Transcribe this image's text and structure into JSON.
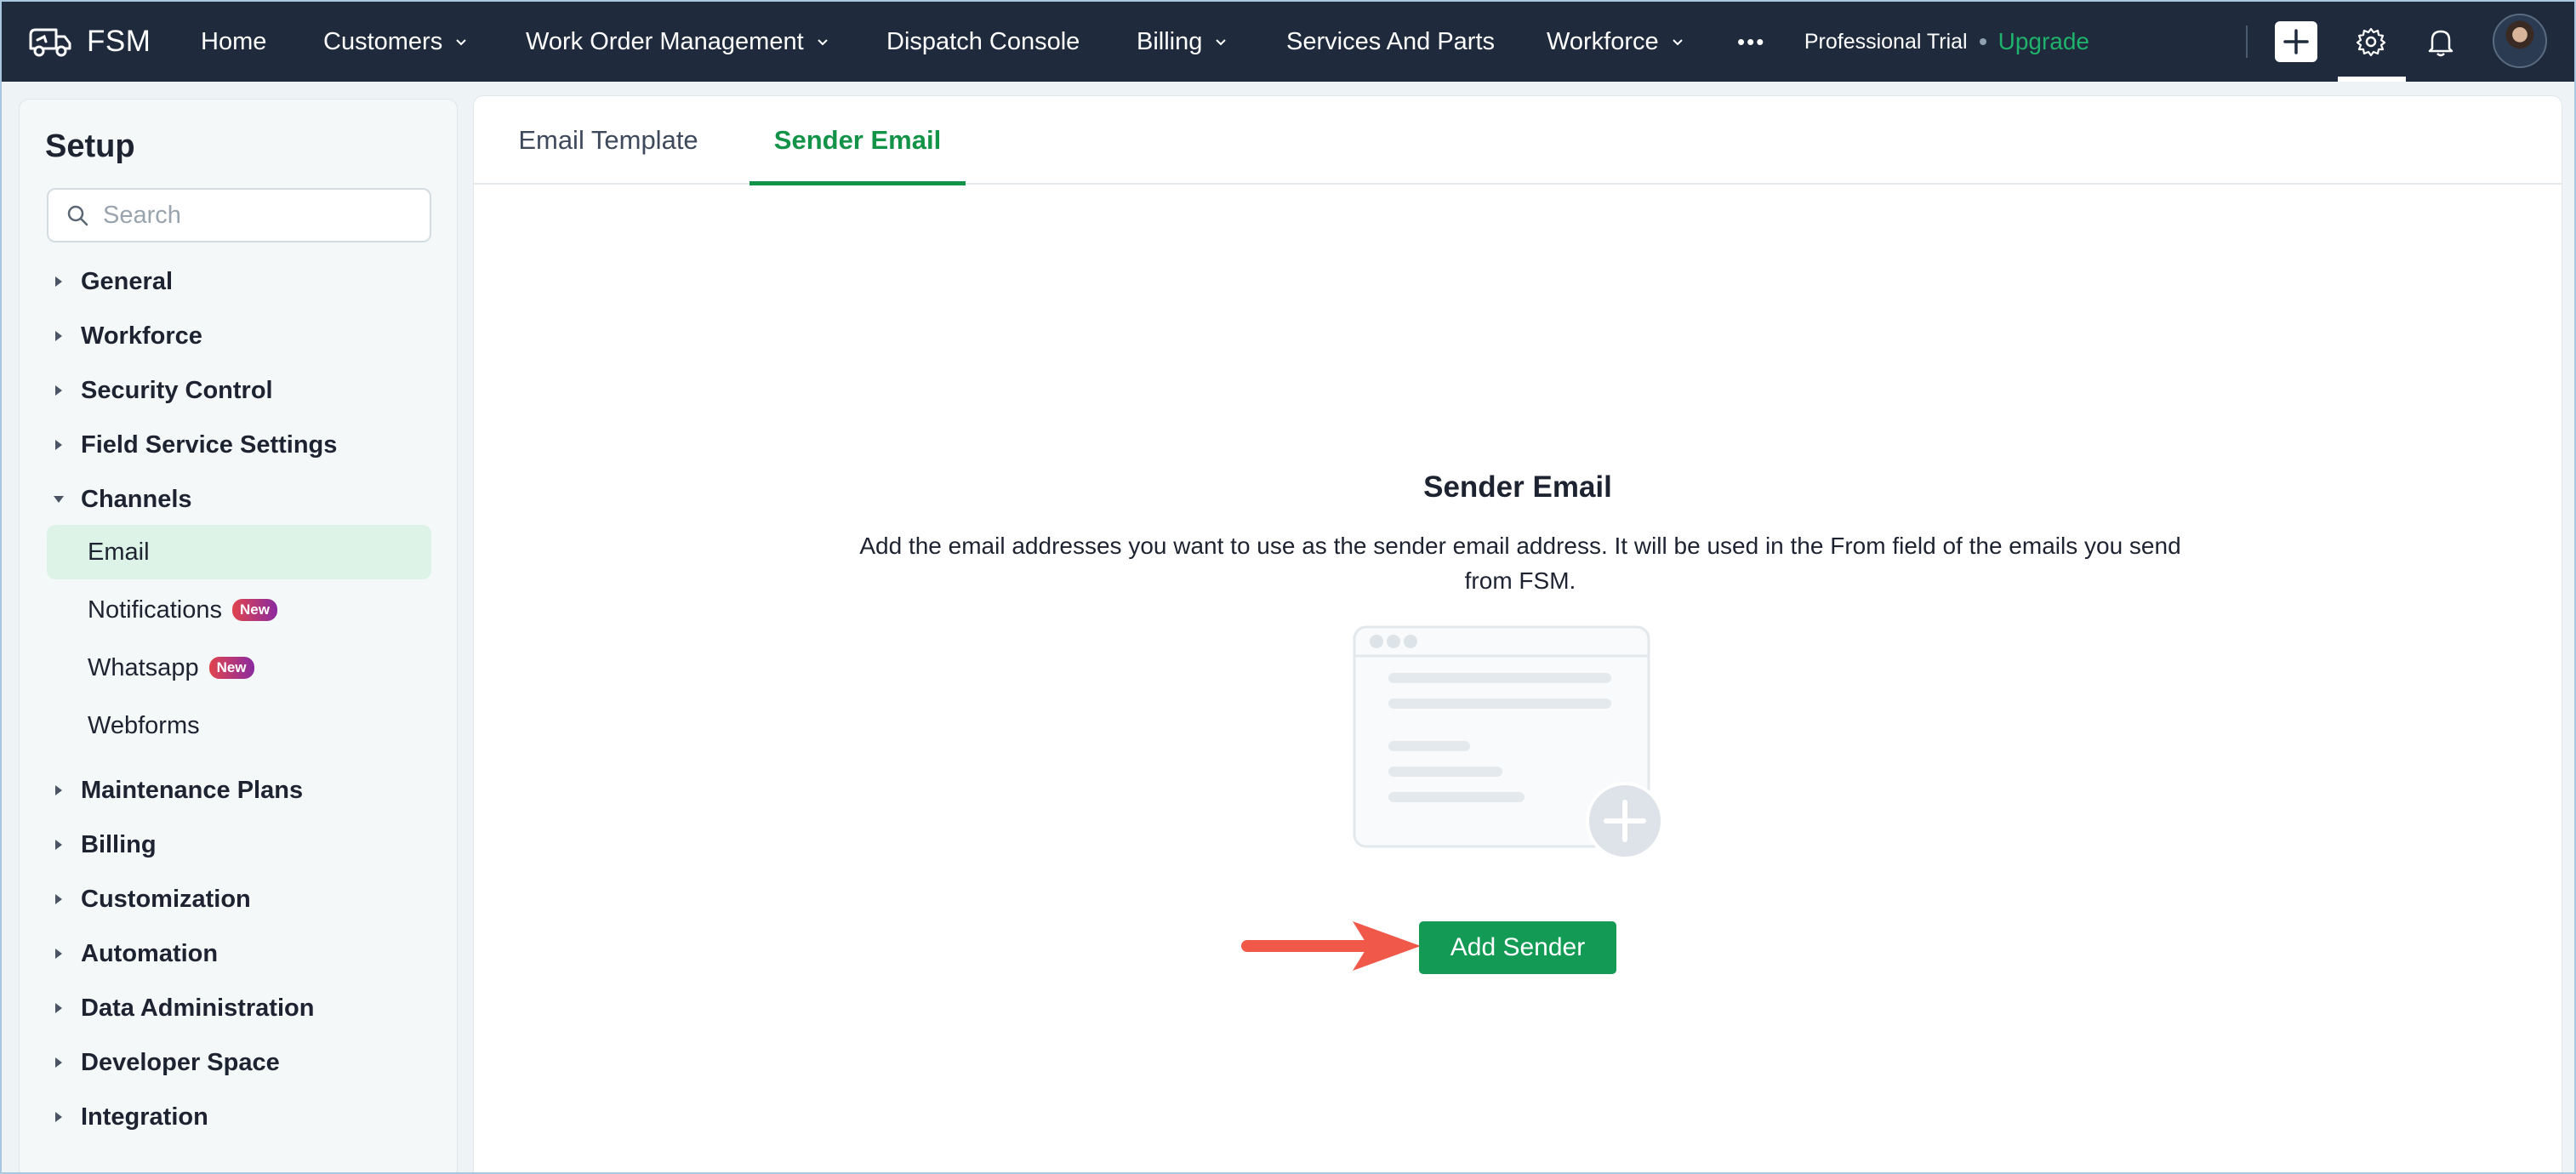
{
  "app": {
    "brand": "FSM",
    "icons": {
      "logo": "truck-logo-icon",
      "create": "plus-icon",
      "settings": "gear-icon",
      "notifications": "bell-icon",
      "profile": "user-avatar"
    }
  },
  "nav": {
    "items": [
      {
        "label": "Home",
        "has_dropdown": false
      },
      {
        "label": "Customers",
        "has_dropdown": true
      },
      {
        "label": "Work Order Management",
        "has_dropdown": true
      },
      {
        "label": "Dispatch Console",
        "has_dropdown": false
      },
      {
        "label": "Billing",
        "has_dropdown": true
      },
      {
        "label": "Services And Parts",
        "has_dropdown": false
      },
      {
        "label": "Workforce",
        "has_dropdown": true
      }
    ],
    "more": "•••",
    "plan": "Professional Trial",
    "upgrade": "Upgrade"
  },
  "sidebar": {
    "title": "Setup",
    "search_placeholder": "Search",
    "sections": [
      {
        "label": "General",
        "expanded": false
      },
      {
        "label": "Workforce",
        "expanded": false
      },
      {
        "label": "Security Control",
        "expanded": false
      },
      {
        "label": "Field Service Settings",
        "expanded": false
      },
      {
        "label": "Channels",
        "expanded": true
      },
      {
        "label": "Maintenance Plans",
        "expanded": false
      },
      {
        "label": "Billing",
        "expanded": false
      },
      {
        "label": "Customization",
        "expanded": false
      },
      {
        "label": "Automation",
        "expanded": false
      },
      {
        "label": "Data Administration",
        "expanded": false
      },
      {
        "label": "Developer Space",
        "expanded": false
      },
      {
        "label": "Integration",
        "expanded": false
      }
    ],
    "channels": [
      {
        "label": "Email",
        "active": true,
        "badge": ""
      },
      {
        "label": "Notifications",
        "active": false,
        "badge": "New"
      },
      {
        "label": "Whatsapp",
        "active": false,
        "badge": "New"
      },
      {
        "label": "Webforms",
        "active": false,
        "badge": ""
      }
    ]
  },
  "main": {
    "tabs": [
      {
        "label": "Email Template",
        "active": false
      },
      {
        "label": "Sender Email",
        "active": true
      }
    ],
    "empty_state": {
      "title": "Sender Email",
      "description": "Add the email addresses you want to use as the sender email address. It will be used in the From field of the emails you send from FSM.",
      "button": "Add Sender"
    }
  },
  "colors": {
    "topbar": "#1f2b3d",
    "accent_green": "#129348",
    "upgrade_green": "#1fb26a",
    "arrow_red": "#f0584a",
    "active_item_bg": "#ddf3e8"
  }
}
